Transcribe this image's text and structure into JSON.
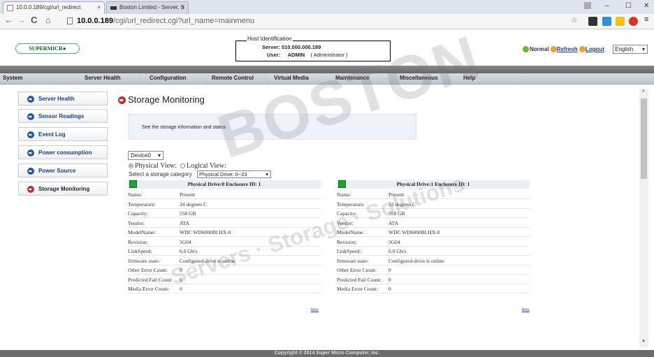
{
  "browser": {
    "tabs": [
      {
        "title": "10.0.0.189/cgi/url_redirect",
        "close": "×"
      },
      {
        "title": "Boston Limited - Server, S",
        "close": "×"
      }
    ],
    "url_host": "10.0.0.189",
    "url_path": "/cgi/url_redirect.cgi?url_name=mainmenu",
    "nav": {
      "back": "←",
      "forward": "→",
      "reload": "C",
      "home": "⌂"
    },
    "window_buttons": {
      "min": "–",
      "max": "☐",
      "close": "✕"
    }
  },
  "header": {
    "logo_text": "SUPERMICR●",
    "host_legend": "Host Identification",
    "server_label": "Server:",
    "server_value": "010.000.000.189",
    "user_label": "User:",
    "user_value": "ADMIN",
    "user_role": "( Administrator )",
    "status_link": "Normal",
    "refresh_link": "Refresh",
    "logout_link": "Logout",
    "language": "English"
  },
  "menu": [
    "System",
    "Server Health",
    "Configuration",
    "Remote Control",
    "Virtual Media",
    "Maintenance",
    "Miscellaneous",
    "Help"
  ],
  "sidebar": [
    {
      "label": "Server Health"
    },
    {
      "label": "Sensor Readings"
    },
    {
      "label": "Event Log"
    },
    {
      "label": "Power consumption"
    },
    {
      "label": "Power Source"
    },
    {
      "label": "Storage Monitoring"
    }
  ],
  "page": {
    "title": "Storage Monitoring",
    "info_text": "See the storage information and status",
    "device_select": "Device0",
    "physical_view": "Physical View:",
    "logical_view": "Logical View:",
    "category_label": "Select a storage category",
    "category_value": "Physical Drive: 0~23"
  },
  "drives": [
    {
      "header": "Physical Drive:0 Enclosure ID: 1",
      "rows": [
        [
          "Status:",
          "Present"
        ],
        [
          "Temperature:",
          "34 degrees C"
        ],
        [
          "Capacity:",
          "558 GB"
        ],
        [
          "Vendor:",
          "ATA"
        ],
        [
          "ModelName:",
          "WDC WD6000BLHX-0"
        ],
        [
          "Revision:",
          "5G04"
        ],
        [
          "LinkSpeed:",
          "6.0 Gb/s"
        ],
        [
          "firmware state:",
          "Configured-drive is online"
        ],
        [
          "Other Error Count:",
          "0"
        ],
        [
          "Predicted Fail Count:",
          "0"
        ],
        [
          "Media Error Count:",
          "0"
        ]
      ],
      "more": "less"
    },
    {
      "header": "Physical Drive:1 Enclosure ID: 1",
      "rows": [
        [
          "Status:",
          "Present"
        ],
        [
          "Temperature:",
          "33 degrees C"
        ],
        [
          "Capacity:",
          "558 GB"
        ],
        [
          "Vendor:",
          "ATA"
        ],
        [
          "ModelName:",
          "WDC WD6000BLHX-0"
        ],
        [
          "Revision:",
          "5G04"
        ],
        [
          "LinkSpeed:",
          "6.0 Gb/s"
        ],
        [
          "firmware state:",
          "Configured-drive is online"
        ],
        [
          "Other Error Count:",
          "0"
        ],
        [
          "Predicted Fail Count:",
          "0"
        ],
        [
          "Media Error Count:",
          "0"
        ]
      ],
      "more": "less"
    }
  ],
  "watermark": {
    "big": "BOSTON",
    "line1": "Servers · Storage · Solutions"
  },
  "footer": "Copyright © 2014 Super Micro Computer, Inc.",
  "colors": {
    "accent_blue": "#1a3b8c",
    "active_red": "#c62b2b",
    "drive_ok": "#22a33a"
  }
}
